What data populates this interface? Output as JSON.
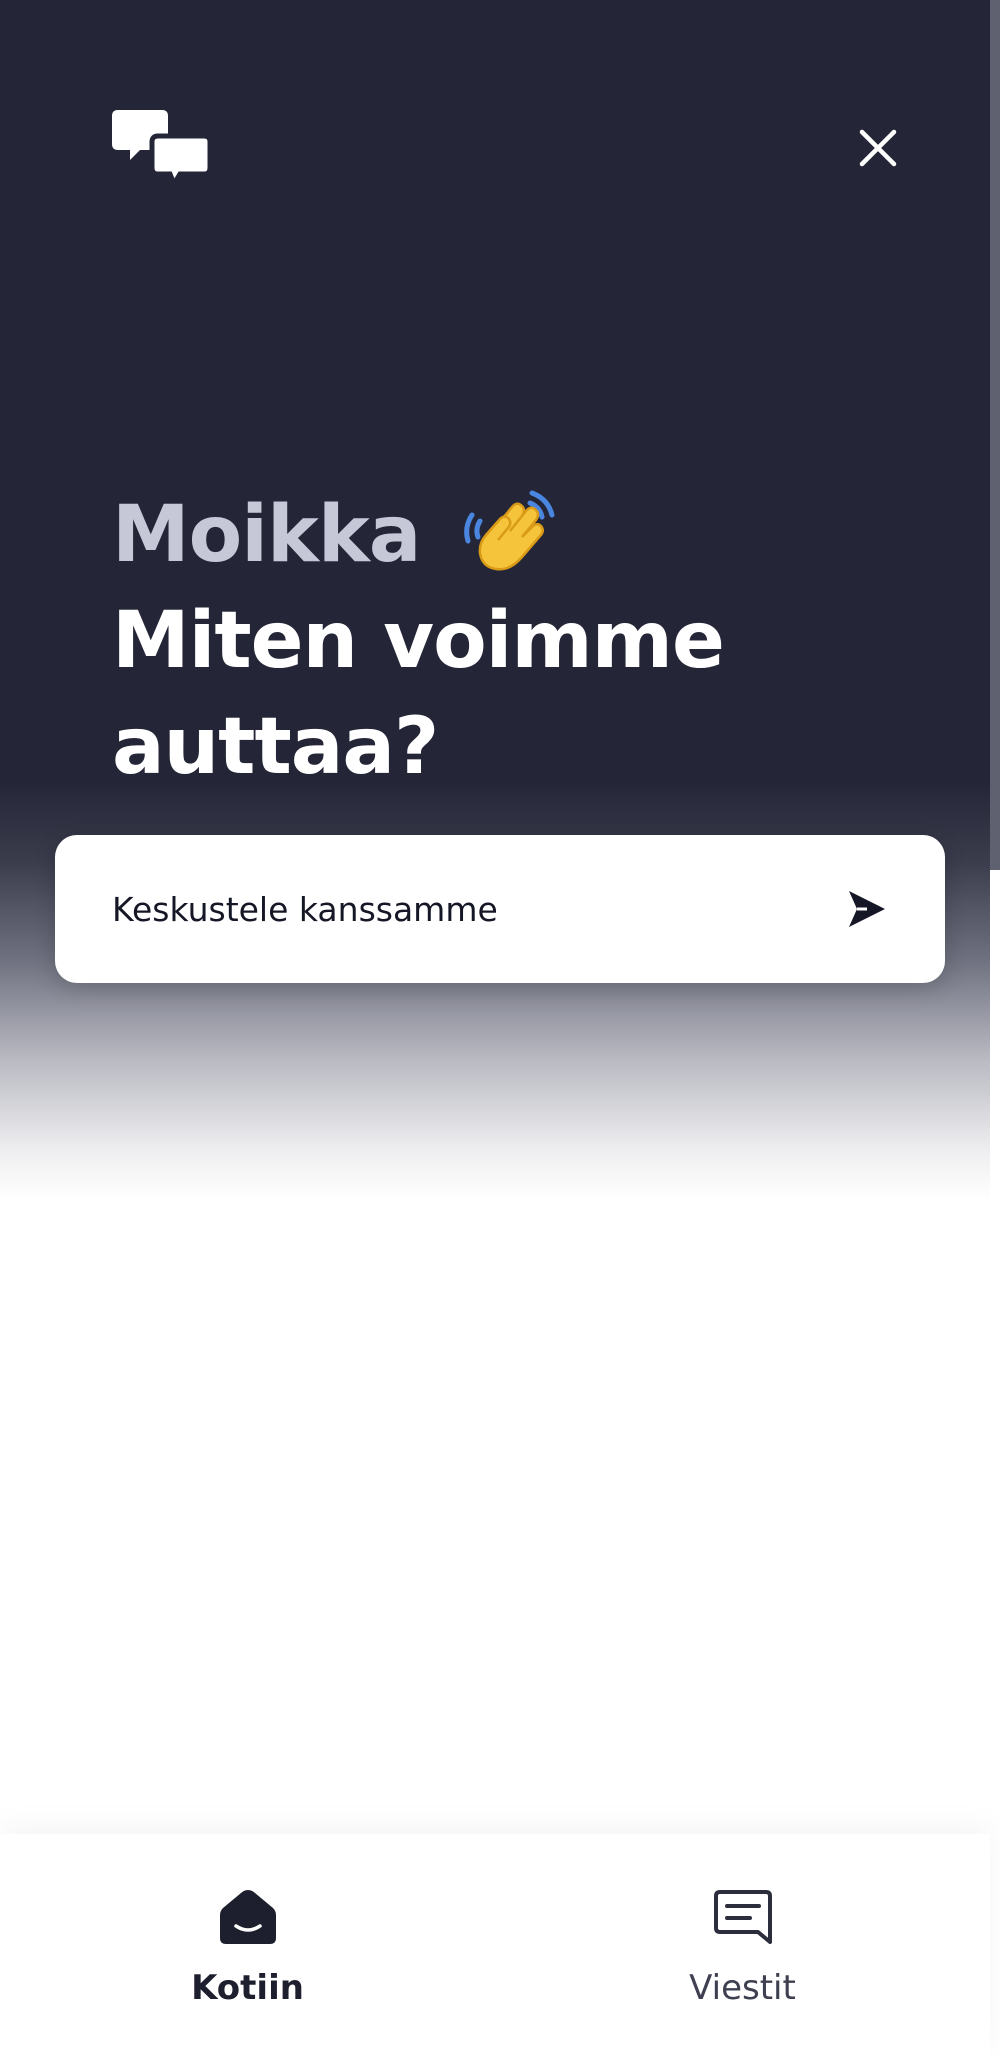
{
  "header": {
    "logo_icon": "chat-bubbles-icon",
    "close_icon": "close-icon"
  },
  "hero": {
    "greeting": "Moikka",
    "greeting_emoji": "waving-hand-icon",
    "question": "Miten voimme auttaa?"
  },
  "chat_card": {
    "label": "Keskustele kanssamme",
    "icon": "send-arrow-icon"
  },
  "bottom_nav": {
    "items": [
      {
        "label": "Kotiin",
        "icon": "home-icon",
        "active": true
      },
      {
        "label": "Viestit",
        "icon": "messages-icon",
        "active": false
      }
    ]
  },
  "colors": {
    "hero_bg": "#242637",
    "greeting_text": "#c6c8d8",
    "question_text": "#ffffff",
    "card_text": "#151726"
  }
}
